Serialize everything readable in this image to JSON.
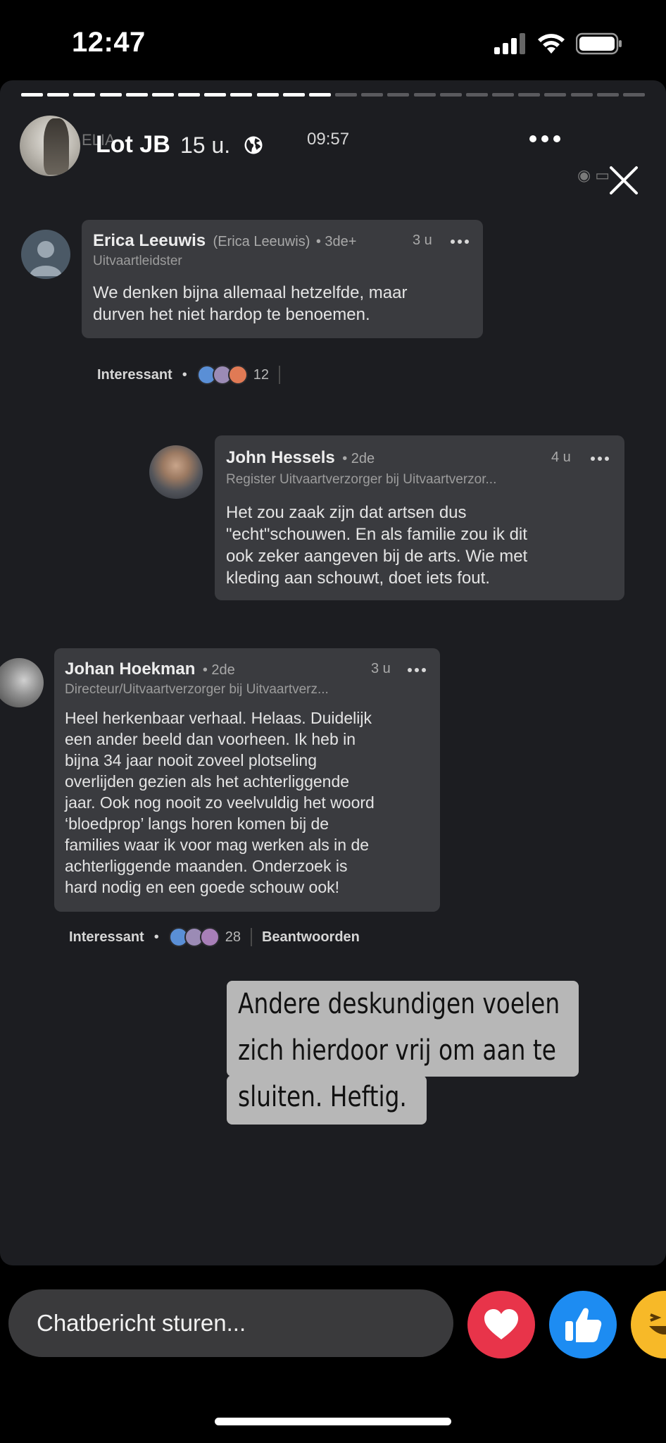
{
  "status_bar": {
    "time": "12:47"
  },
  "story": {
    "author": "Lot JB",
    "age": "15 u.",
    "ghost_label": "ELIA",
    "screenshot_time": "09:57"
  },
  "comments": [
    {
      "name": "Erica Leeuwis",
      "alias": "(Erica Leeuwis)",
      "degree": "• 3de+",
      "time": "3 u",
      "role": "Uitvaartleidster",
      "body_lines": [
        "We denken bijna allemaal hetzelfde, maar",
        "durven het niet hardop te benoemen."
      ],
      "action_label": "Interessant",
      "action_dot": "•",
      "reaction_count": "12"
    },
    {
      "name": "John Hessels",
      "degree": "• 2de",
      "time": "4 u",
      "role": "Register Uitvaartverzorger bij Uitvaartverzor...",
      "body_lines": [
        "Het zou zaak zijn dat artsen dus",
        "\"echt\"schouwen. En als familie zou ik dit",
        "ook zeker aangeven bij de arts. Wie met",
        "kleding aan schouwt, doet iets fout."
      ]
    },
    {
      "name": "Johan Hoekman",
      "degree": "• 2de",
      "time": "3 u",
      "role": "Directeur/Uitvaartverzorger bij Uitvaartverz...",
      "body_lines": [
        "Heel herkenbaar verhaal. Helaas. Duidelijk",
        "een ander beeld dan voorheen. Ik heb in",
        "bijna 34 jaar nooit zoveel plotseling",
        "overlijden gezien als het achterliggende",
        "jaar. Ook nog nooit zo veelvuldig het woord",
        "‘bloedprop’ langs horen komen bij de",
        "families waar ik voor mag werken als in de",
        "achterliggende maanden. Onderzoek is",
        "hard nodig en een goede schouw ook!"
      ],
      "action_label": "Interessant",
      "action_dot": "•",
      "reaction_count": "28",
      "reply_label": "Beantwoorden"
    }
  ],
  "overlay_lines": [
    "Andere deskundigen voelen",
    "zich hierdoor vrij om aan te",
    "sluiten. Heftig."
  ],
  "bottom": {
    "chat_placeholder": "Chatbericht sturen...",
    "reactions": [
      "heart-reaction",
      "like-reaction",
      "laugh-reaction"
    ]
  },
  "colors": {
    "heart": "#e8344a",
    "like": "#1d8cf2",
    "laugh": "#f7b928",
    "overlay_bg": "#b7b7b7",
    "card_bg": "#3a3b3f"
  }
}
